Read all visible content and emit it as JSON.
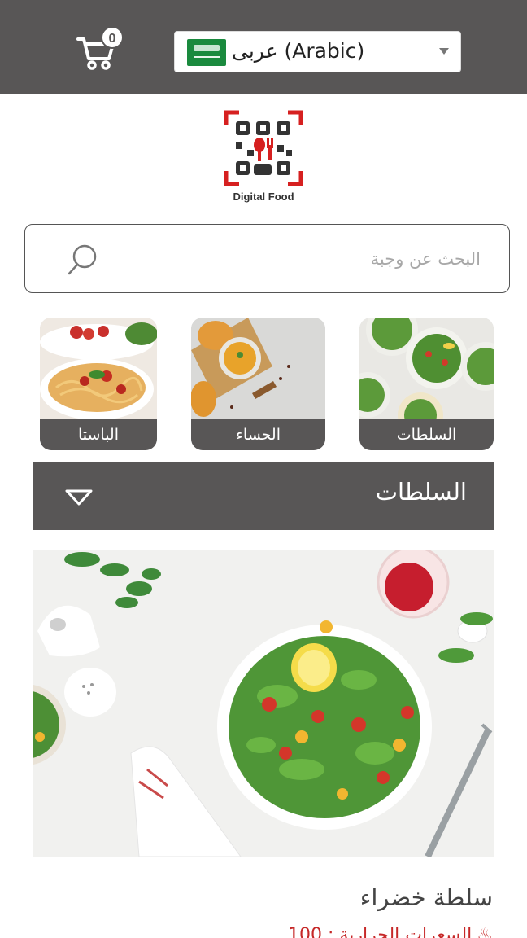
{
  "header": {
    "cart_count": "0",
    "language_label": "عربى (Arabic)"
  },
  "logo": {
    "caption": "Digital Food"
  },
  "search": {
    "placeholder": "البحث عن وجبة"
  },
  "categories": [
    {
      "label": "الباستا",
      "image": "pasta-photo"
    },
    {
      "label": "الحساء",
      "image": "soup-photo"
    },
    {
      "label": "السلطات",
      "image": "salad-photo"
    }
  ],
  "section": {
    "title": "السلطات"
  },
  "dish": {
    "name": "سلطة خضراء",
    "calories": "السعرات الحرارية : 100"
  },
  "colors": {
    "bar": "#585656",
    "accent": "#c62828"
  }
}
